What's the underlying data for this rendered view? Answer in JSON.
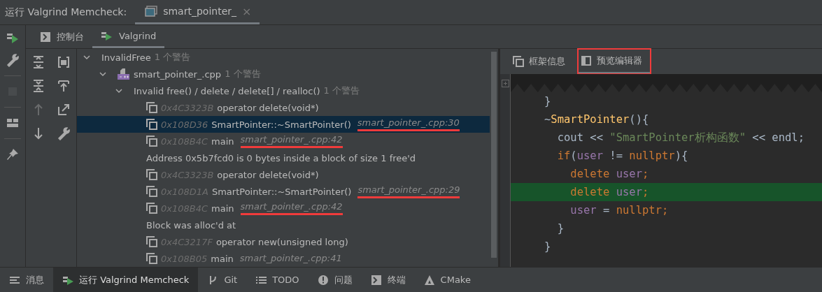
{
  "run_bar": {
    "title": "运行 Valgrind Memcheck:",
    "tabs": [
      {
        "label": "smart_pointer_",
        "close": "×",
        "selected": true
      }
    ]
  },
  "left_toolbar": [
    {
      "kind": "run",
      "disabled": false
    },
    {
      "kind": "wrench",
      "disabled": false
    },
    {
      "kind": "stop",
      "disabled": true
    },
    {
      "kind": "layout",
      "disabled": false
    },
    {
      "kind": "pin",
      "disabled": false
    }
  ],
  "sub_tabs": [
    {
      "label": "控制台",
      "kind": "console",
      "selected": false
    },
    {
      "label": "Valgrind",
      "kind": "run",
      "selected": true
    }
  ],
  "tree_toolbar": [
    {
      "kind": "expand",
      "disabled": false
    },
    {
      "kind": "bracket",
      "disabled": false
    },
    {
      "kind": "collapse",
      "disabled": false
    },
    {
      "kind": "to-top",
      "disabled": false
    },
    {
      "kind": "up",
      "disabled": true
    },
    {
      "kind": "export",
      "disabled": false
    },
    {
      "kind": "down",
      "disabled": false
    },
    {
      "kind": "wrench",
      "disabled": false
    }
  ],
  "tree": [
    {
      "kind": "group",
      "label": "InvalidFree",
      "count": "1 个警告",
      "expanded": true,
      "children": [
        {
          "kind": "file",
          "label": "smart_pointer_.cpp",
          "count": "1 个警告",
          "expanded": true,
          "children": [
            {
              "kind": "group",
              "label": "Invalid free() / delete / delete[] / realloc()",
              "count": "1 个警告",
              "expanded": true,
              "children": [
                {
                  "kind": "frame",
                  "address": "0x4C3323B",
                  "func": "operator delete(void*)",
                  "selected": false
                },
                {
                  "kind": "frame",
                  "address": "0x108D36",
                  "func": "SmartPointer::~SmartPointer()",
                  "location": "smart_pointer_.cpp:30",
                  "underlined": true,
                  "selected": true
                },
                {
                  "kind": "frame",
                  "address": "0x108B4C",
                  "func": "main",
                  "location": "smart_pointer_.cpp:42",
                  "underlined": true,
                  "selected": false
                },
                {
                  "kind": "message",
                  "text": "Address 0x5b7fcd0 is 0 bytes inside a block of size 1 free'd"
                },
                {
                  "kind": "frame",
                  "address": "0x4C3323B",
                  "func": "operator delete(void*)",
                  "selected": false
                },
                {
                  "kind": "frame",
                  "address": "0x108D1A",
                  "func": "SmartPointer::~SmartPointer()",
                  "location": "smart_pointer_.cpp:29",
                  "underlined": true,
                  "selected": false
                },
                {
                  "kind": "frame",
                  "address": "0x108B4C",
                  "func": "main",
                  "location": "smart_pointer_.cpp:42",
                  "underlined": true,
                  "selected": false
                },
                {
                  "kind": "message",
                  "text": "Block was alloc'd at"
                },
                {
                  "kind": "frame",
                  "address": "0x4C3217F",
                  "func": "operator new(unsigned long)",
                  "selected": false
                },
                {
                  "kind": "frame",
                  "address": "0x108B05",
                  "func": "main",
                  "location": "smart_pointer_.cpp:41",
                  "underlined": false,
                  "selected": false
                }
              ]
            }
          ]
        }
      ]
    }
  ],
  "detail_tabs": [
    {
      "label": "框架信息",
      "kind": "frames",
      "selected": false,
      "annotated": false
    },
    {
      "label": "预览编辑器",
      "kind": "preview",
      "selected": true,
      "annotated": true
    }
  ],
  "code": [
    {
      "highlighted": false,
      "tokens": [
        {
          "kind": "plain",
          "text": "}"
        }
      ]
    },
    {
      "highlighted": false,
      "tokens": [
        {
          "kind": "plain",
          "text": "~"
        },
        {
          "kind": "fn",
          "text": "SmartPointer"
        },
        {
          "kind": "plain",
          "text": "(){"
        }
      ]
    },
    {
      "highlighted": false,
      "tokens": [
        {
          "kind": "plain",
          "text": "  cout << "
        },
        {
          "kind": "str",
          "text": "\"SmartPointer析构函数\""
        },
        {
          "kind": "plain",
          "text": " << endl;"
        }
      ]
    },
    {
      "highlighted": false,
      "tokens": [
        {
          "kind": "kw",
          "text": "  if"
        },
        {
          "kind": "plain",
          "text": "("
        },
        {
          "kind": "var",
          "text": "user"
        },
        {
          "kind": "plain",
          "text": " != "
        },
        {
          "kind": "kw",
          "text": "nullptr"
        },
        {
          "kind": "plain",
          "text": "){"
        }
      ]
    },
    {
      "highlighted": false,
      "tokens": [
        {
          "kind": "kw",
          "text": "    delete "
        },
        {
          "kind": "var",
          "text": "user"
        },
        {
          "kind": "kw",
          "text": ";"
        }
      ]
    },
    {
      "highlighted": true,
      "tokens": [
        {
          "kind": "kw",
          "text": "    delete "
        },
        {
          "kind": "var",
          "text": "user"
        },
        {
          "kind": "kw",
          "text": ";"
        }
      ]
    },
    {
      "highlighted": false,
      "tokens": [
        {
          "kind": "var",
          "text": "    user"
        },
        {
          "kind": "plain",
          "text": " = "
        },
        {
          "kind": "kw",
          "text": "nullptr;"
        }
      ]
    },
    {
      "highlighted": false,
      "tokens": [
        {
          "kind": "plain",
          "text": "  }"
        }
      ]
    },
    {
      "highlighted": false,
      "tokens": [
        {
          "kind": "plain",
          "text": "}"
        }
      ]
    }
  ],
  "bottom_tabs": [
    {
      "label": "消息",
      "kind": "lines",
      "selected": false
    },
    {
      "label": "运行 Valgrind Memcheck",
      "kind": "run",
      "selected": true
    },
    {
      "label": "Git",
      "kind": "branch",
      "selected": false
    },
    {
      "label": "TODO",
      "kind": "list",
      "selected": false
    },
    {
      "label": "问题",
      "kind": "alert",
      "selected": false
    },
    {
      "label": "终端",
      "kind": "console",
      "selected": false
    },
    {
      "label": "CMake",
      "kind": "triangle",
      "selected": false
    }
  ]
}
